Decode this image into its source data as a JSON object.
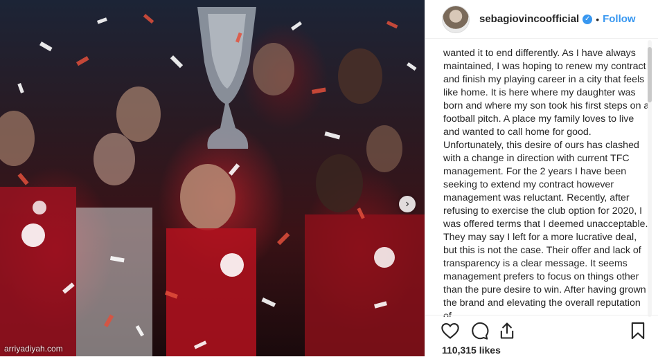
{
  "watermark": "arriyadiyah.com",
  "post": {
    "username": "sebagiovincoofficial",
    "separator": "•",
    "follow_label": "Follow",
    "verified_glyph": "✓",
    "caption": "wanted it to end differently. As I have always maintained, I was hoping to renew my contract and finish my playing career in a city that feels like home. It is here where my daughter was born and where my son took his first steps on a football pitch. A place my family loves to live and wanted to call home for good. Unfortunately, this desire of ours has clashed with a change in direction with current TFC management. For the 2 years I have been seeking to extend my contract however management was reluctant. Recently, after refusing to exercise the club option for 2020, I was offered terms that I deemed unacceptable. They may say I left for a more lucrative deal, but this is not the case. Their offer and lack of transparency is a clear message. It seems management prefers to focus on things other than the pure desire to win. After having grown the brand and elevating the overall reputation of",
    "likes": "110,315 likes"
  },
  "icons": {
    "like": "heart-icon",
    "comment": "comment-icon",
    "share": "share-icon",
    "save": "bookmark-icon",
    "next": "chevron-right-icon",
    "verified": "verified-badge-icon"
  },
  "colors": {
    "accent": "#3897f0",
    "text": "#262626",
    "border": "#efefef"
  }
}
